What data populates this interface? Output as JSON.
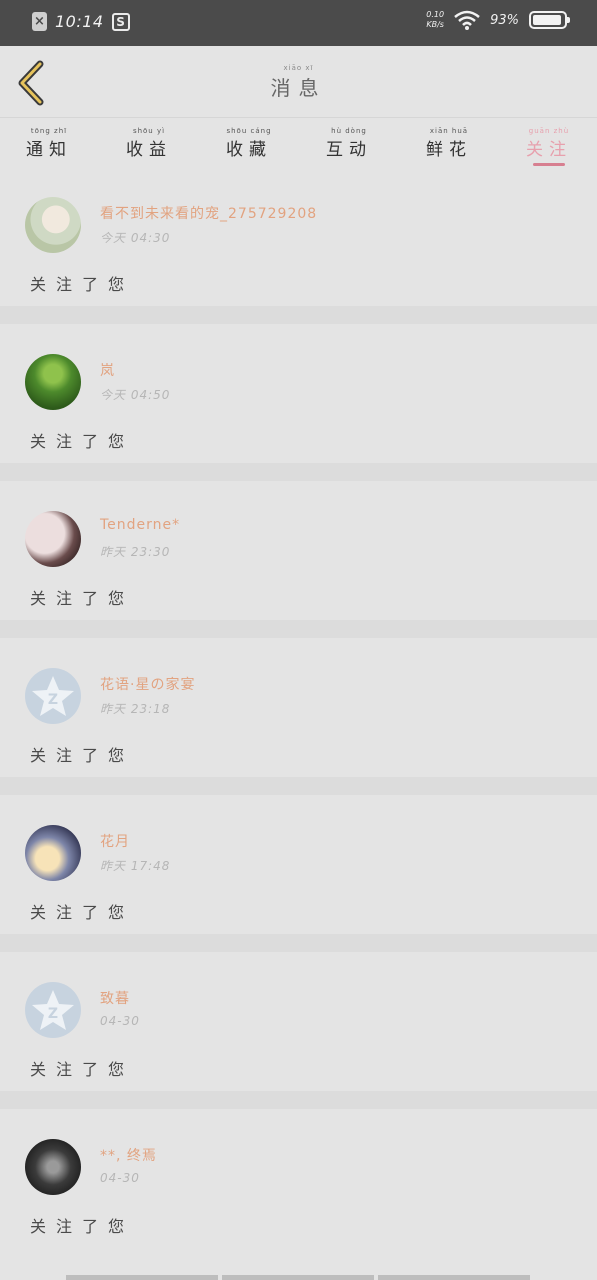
{
  "status": {
    "time": "10:14",
    "net_speed_value": "0.10",
    "net_speed_unit": "KB/s",
    "battery": "93%",
    "battery_level": 0.93,
    "icons": [
      "notification-x-icon",
      "s-app-icon",
      "wifi-icon",
      "battery-icon"
    ]
  },
  "header": {
    "title": "消息",
    "title_pinyin": "xiāo xī",
    "back_icon": "chevron-left-icon"
  },
  "tabs": [
    {
      "label": "通知",
      "pinyin": "tōng zhī",
      "active": false
    },
    {
      "label": "收益",
      "pinyin": "shōu yì",
      "active": false
    },
    {
      "label": "收藏",
      "pinyin": "shōu cáng",
      "active": false
    },
    {
      "label": "互动",
      "pinyin": "hù dòng",
      "active": false
    },
    {
      "label": "鲜花",
      "pinyin": "xiān huā",
      "active": false
    },
    {
      "label": "关注",
      "pinyin": "guān zhù",
      "active": true
    }
  ],
  "items": [
    {
      "name": "看不到未来看的宠_275729208",
      "date": "今天 04:30",
      "action": "关注了您"
    },
    {
      "name": "岚",
      "date": "今天 04:50",
      "action": "关注了您"
    },
    {
      "name": "Tenderne*",
      "date": "昨天 23:30",
      "action": "关注了您"
    },
    {
      "name": "花语·星の家宴",
      "date": "昨天 23:18",
      "action": "关注了您"
    },
    {
      "name": "花月",
      "date": "昨天 17:48",
      "action": "关注了您"
    },
    {
      "name": "致暮",
      "date": "04-30",
      "action": "关注了您"
    },
    {
      "name": "**, 终焉",
      "date": "04-30",
      "action": "关注了您"
    }
  ],
  "colors": {
    "accent": "#d77f90",
    "name": "#e2a380",
    "statusbar": "#4b4b4b",
    "background": "#e4e4e4"
  }
}
